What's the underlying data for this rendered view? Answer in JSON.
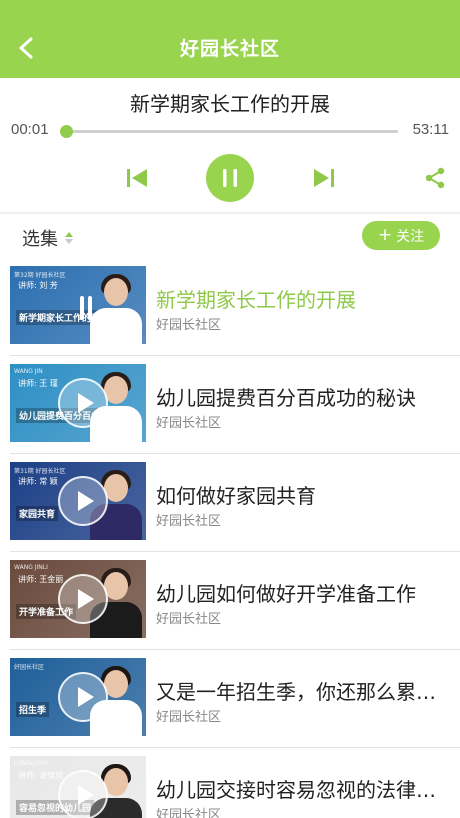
{
  "header": {
    "title": "好园长社区",
    "back_icon": "chevron-left-icon",
    "background": "#99d44f"
  },
  "player": {
    "track_title": "新学期家长工作的开展",
    "current_time": "00:01",
    "total_time": "53:11",
    "progress_fraction": 0.0,
    "state": "playing",
    "accent": "#99d44f"
  },
  "episodes": {
    "label": "选集",
    "follow_label": "关注"
  },
  "list": [
    {
      "title": "新学期家长工作的开展",
      "subtitle": "好园长社区",
      "active": true,
      "thumb": {
        "bg": "#2c6fb0",
        "header": "第32期 好园长社区",
        "name": "讲师: 刘 芳",
        "caption": "新学期家长工作的开展",
        "body": "#ffffff",
        "hair": "#2a1d18"
      }
    },
    {
      "title": "幼儿园提费百分百成功的秘诀",
      "subtitle": "好园长社区",
      "active": false,
      "thumb": {
        "bg": "#2e8fc4",
        "header": "WANG JIN",
        "name": "讲师: 王 瑾",
        "caption": "幼儿园提费百分百成功秘诀",
        "body": "#ffffff",
        "hair": "#2a1d18"
      }
    },
    {
      "title": "如何做好家园共育",
      "subtitle": "好园长社区",
      "active": false,
      "thumb": {
        "bg": "#1c3f86",
        "header": "第31期 好园长社区",
        "name": "讲师: 常 颖",
        "caption": "家园共育",
        "body": "#2e2a66",
        "hair": "#2a1d18"
      }
    },
    {
      "title": "幼儿园如何做好开学准备工作",
      "subtitle": "好园长社区",
      "active": false,
      "thumb": {
        "bg": "#6a4a3c",
        "header": "WANG JINLI",
        "name": "讲师: 王金丽",
        "caption": "开学准备工作",
        "body": "#1b1b1b",
        "hair": "#2a1d18"
      }
    },
    {
      "title": "又是一年招生季，你还那么累…",
      "subtitle": "好园长社区",
      "active": false,
      "thumb": {
        "bg": "#1f5f9a",
        "header": "好园长社区",
        "name": "",
        "caption": "招生季",
        "body": "#ffffff",
        "hair": "#1d1612"
      }
    },
    {
      "title": "幼儿园交接时容易忽视的法律…",
      "subtitle": "好园长社区",
      "active": false,
      "thumb": {
        "bg": "#e8e8e8",
        "header": "LONGLVSHI",
        "name": "讲师: 龙律师",
        "caption": "容易忽视的幼儿园",
        "body": "#2b2b2b",
        "hair": "#1d1612"
      }
    }
  ]
}
